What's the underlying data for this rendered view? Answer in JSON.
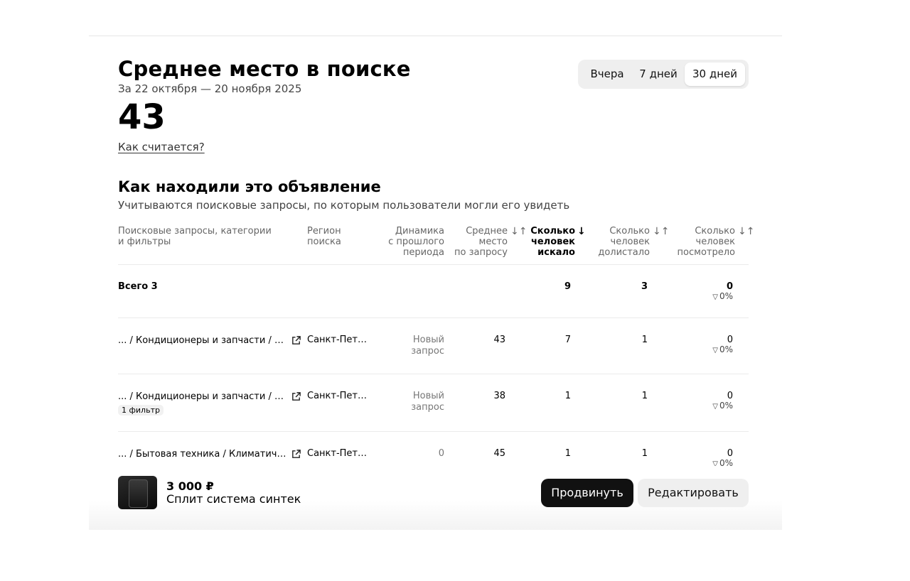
{
  "header": {
    "title": "Среднее место в поиске",
    "period": "За 22 октября — 20 ноября 2025",
    "value": "43",
    "how_link": "Как считается?",
    "periods": [
      "Вчера",
      "7 дней",
      "30 дней"
    ],
    "selected_period": "30 дней"
  },
  "section": {
    "title": "Как находили это объявление",
    "subtitle": "Учитываются поисковые запросы, по которым пользователи могли его увидеть"
  },
  "table": {
    "columns": {
      "query": [
        "Поисковые запросы, категории",
        "и фильтры"
      ],
      "region": [
        "Регион",
        "поиска"
      ],
      "dynamics": [
        "Динамика",
        "с прошлого",
        "периода"
      ],
      "avg_place": [
        "Среднее",
        "место",
        "по запросу"
      ],
      "searched": [
        "Сколько",
        "человек",
        "искало"
      ],
      "scrolled": [
        "Сколько",
        "человек",
        "долистало"
      ],
      "viewed": [
        "Сколько",
        "человек",
        "посмотрело"
      ]
    },
    "sort_icons": {
      "avg_place": "↓↑",
      "searched": "↓",
      "scrolled": "↓↑",
      "viewed": "↓↑"
    },
    "total": {
      "label": "Всего 3",
      "searched": "9",
      "scrolled": "3",
      "viewed": "0",
      "viewed_pct": "0%"
    },
    "rows": [
      {
        "query": "... / Кондиционеры и запчасти / Кондиционеры",
        "filter": "",
        "region": "Санкт-Петербург",
        "dynamics": [
          "Новый",
          "запрос"
        ],
        "avg_place": "43",
        "searched": "7",
        "scrolled": "1",
        "viewed": "0",
        "viewed_pct": "0%"
      },
      {
        "query": "... / Кондиционеры и запчасти / Кондиционеры",
        "filter": "1 фильтр",
        "region": "Санкт-Петербург",
        "dynamics": [
          "Новый",
          "запрос"
        ],
        "avg_place": "38",
        "searched": "1",
        "scrolled": "1",
        "viewed": "0",
        "viewed_pct": "0%"
      },
      {
        "query": "... / Бытовая техника / Климатическое оборудование",
        "filter": "",
        "region": "Санкт-Петербург",
        "dynamics": [
          "0",
          ""
        ],
        "avg_place": "45",
        "searched": "1",
        "scrolled": "1",
        "viewed": "0",
        "viewed_pct": "0%"
      }
    ]
  },
  "footer": {
    "price": "3 000 ₽",
    "name": "Сплит система синтек",
    "promote_label": "Продвинуть",
    "edit_label": "Редактировать"
  }
}
